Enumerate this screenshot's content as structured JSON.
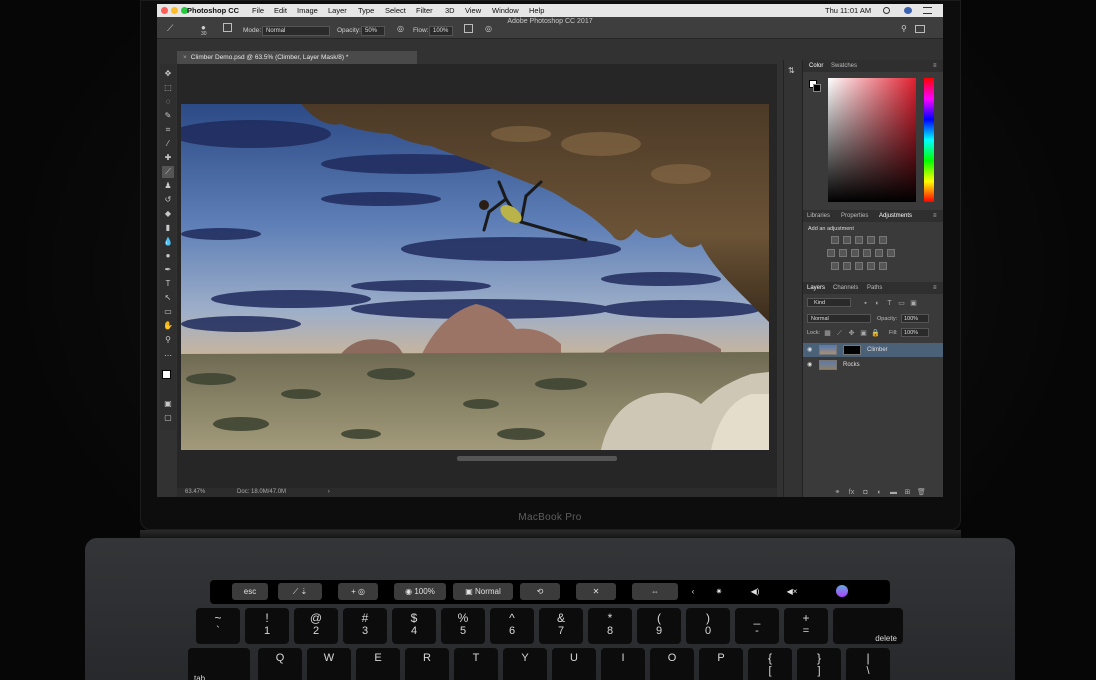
{
  "menubar": {
    "app": "Photoshop CC",
    "items": [
      "File",
      "Edit",
      "Image",
      "Layer",
      "Type",
      "Select",
      "Filter",
      "3D",
      "View",
      "Window",
      "Help"
    ],
    "clock": "Thu 11:01 AM"
  },
  "window_title": "Adobe Photoshop CC 2017",
  "options_bar": {
    "brush_size": "30",
    "mode_label": "Mode:",
    "mode_value": "Normal",
    "opacity_label": "Opacity:",
    "opacity_value": "50%",
    "flow_label": "Flow:",
    "flow_value": "100%"
  },
  "document": {
    "tab": "Climber Demo.psd @ 63.5% (Climber, Layer Mask/8) *",
    "zoom_status": "63.47%",
    "doc_status": "Doc: 18.0M/47.0M"
  },
  "color_panel": {
    "tabs": [
      "Color",
      "Swatches"
    ]
  },
  "adjustments_panel": {
    "tabs": [
      "Libraries",
      "Properties",
      "Adjustments"
    ],
    "hint": "Add an adjustment"
  },
  "layers_panel": {
    "tabs": [
      "Layers",
      "Channels",
      "Paths"
    ],
    "filter": "Kind",
    "blend_mode": "Normal",
    "opacity_label": "Opacity:",
    "opacity_value": "100%",
    "lock_label": "Lock:",
    "fill_label": "Fill:",
    "fill_value": "100%",
    "layers": [
      {
        "name": "Climber",
        "selected": true
      },
      {
        "name": "Rocks",
        "selected": false
      }
    ]
  },
  "brand": "MacBook Pro",
  "touch_bar": {
    "esc": "esc",
    "brush": "100%",
    "mode": "Normal"
  },
  "keyboard": {
    "row1": [
      [
        "~",
        "`"
      ],
      [
        "!",
        "1"
      ],
      [
        "@",
        "2"
      ],
      [
        "#",
        "3"
      ],
      [
        "$",
        "4"
      ],
      [
        "%",
        "5"
      ],
      [
        "^",
        "6"
      ],
      [
        "&",
        "7"
      ],
      [
        "*",
        "8"
      ],
      [
        "(",
        "9"
      ],
      [
        ")",
        "0"
      ],
      [
        "_",
        "-"
      ],
      [
        "+",
        "="
      ]
    ],
    "delete": "delete",
    "tab": "tab",
    "row2": [
      [
        "",
        "Q"
      ],
      [
        "",
        "W"
      ],
      [
        "",
        "E"
      ],
      [
        "",
        "R"
      ],
      [
        "",
        "T"
      ],
      [
        "",
        "Y"
      ],
      [
        "",
        "U"
      ],
      [
        "",
        "I"
      ],
      [
        "",
        "O"
      ],
      [
        "",
        "P"
      ],
      [
        "{",
        "["
      ],
      [
        "}",
        "]"
      ],
      [
        "|",
        "\\"
      ]
    ]
  },
  "colors": {
    "accent": "#2d80c8",
    "panel": "#3a3a3a",
    "canvas_bg": "#262626"
  }
}
